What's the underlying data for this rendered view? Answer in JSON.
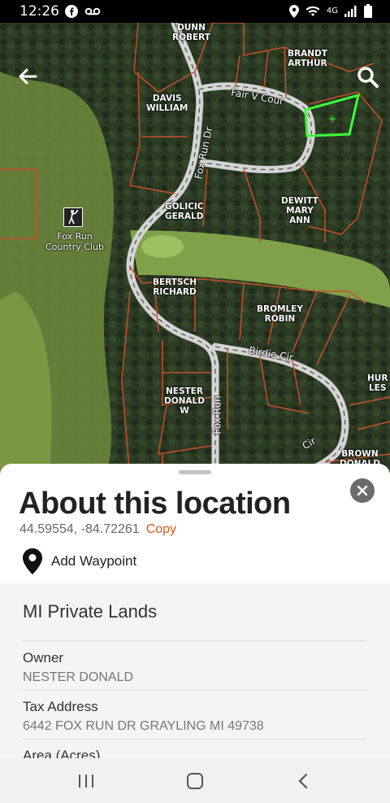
{
  "status_bar": {
    "time": "12:26",
    "left_icons": [
      "facebook-icon",
      "voicemail-icon"
    ],
    "right_icons": [
      "location-icon",
      "wifi-icon",
      "4g-icon",
      "signal-icon",
      "battery-icon"
    ],
    "network": "4G"
  },
  "map": {
    "parcels": [
      {
        "owner": "DUNN\nROBERT"
      },
      {
        "owner": "BRANDT\nARTHUR"
      },
      {
        "owner": "DAVIS\nWILLIAM"
      },
      {
        "owner": "GOLICIC\nGERALD"
      },
      {
        "owner": "DEWITT\nMARY\nANN"
      },
      {
        "owner": "BERTSCH\nRICHARD"
      },
      {
        "owner": "BROMLEY\nROBIN"
      },
      {
        "owner": "NESTER\nDONALD\nW"
      },
      {
        "owner": "HUR\nLES"
      },
      {
        "owner": "BROWN\nDONALD"
      }
    ],
    "roads": [
      "Fair V Cour",
      "Fox Run Dr",
      "Birdie Cir",
      "Fox Run",
      "Cir"
    ],
    "poi": {
      "name": "Fox Run\nCountry Club",
      "icon": "golf-icon"
    },
    "colors": {
      "parcel_line": "#c8502a",
      "highlight": "#3cff3c"
    }
  },
  "sheet": {
    "title": "About this location",
    "coordinates": "44.59554, -84.72261",
    "copy_label": "Copy",
    "waypoint_label": "Add Waypoint",
    "section_title": "MI Private Lands",
    "fields": [
      {
        "label": "Owner",
        "value": "NESTER DONALD"
      },
      {
        "label": "Tax Address",
        "value": "6442 FOX RUN DR GRAYLING MI 49738"
      },
      {
        "label": "Area (Acres)",
        "value": ""
      }
    ]
  },
  "nav": [
    "recents-button",
    "home-button",
    "back-button"
  ]
}
